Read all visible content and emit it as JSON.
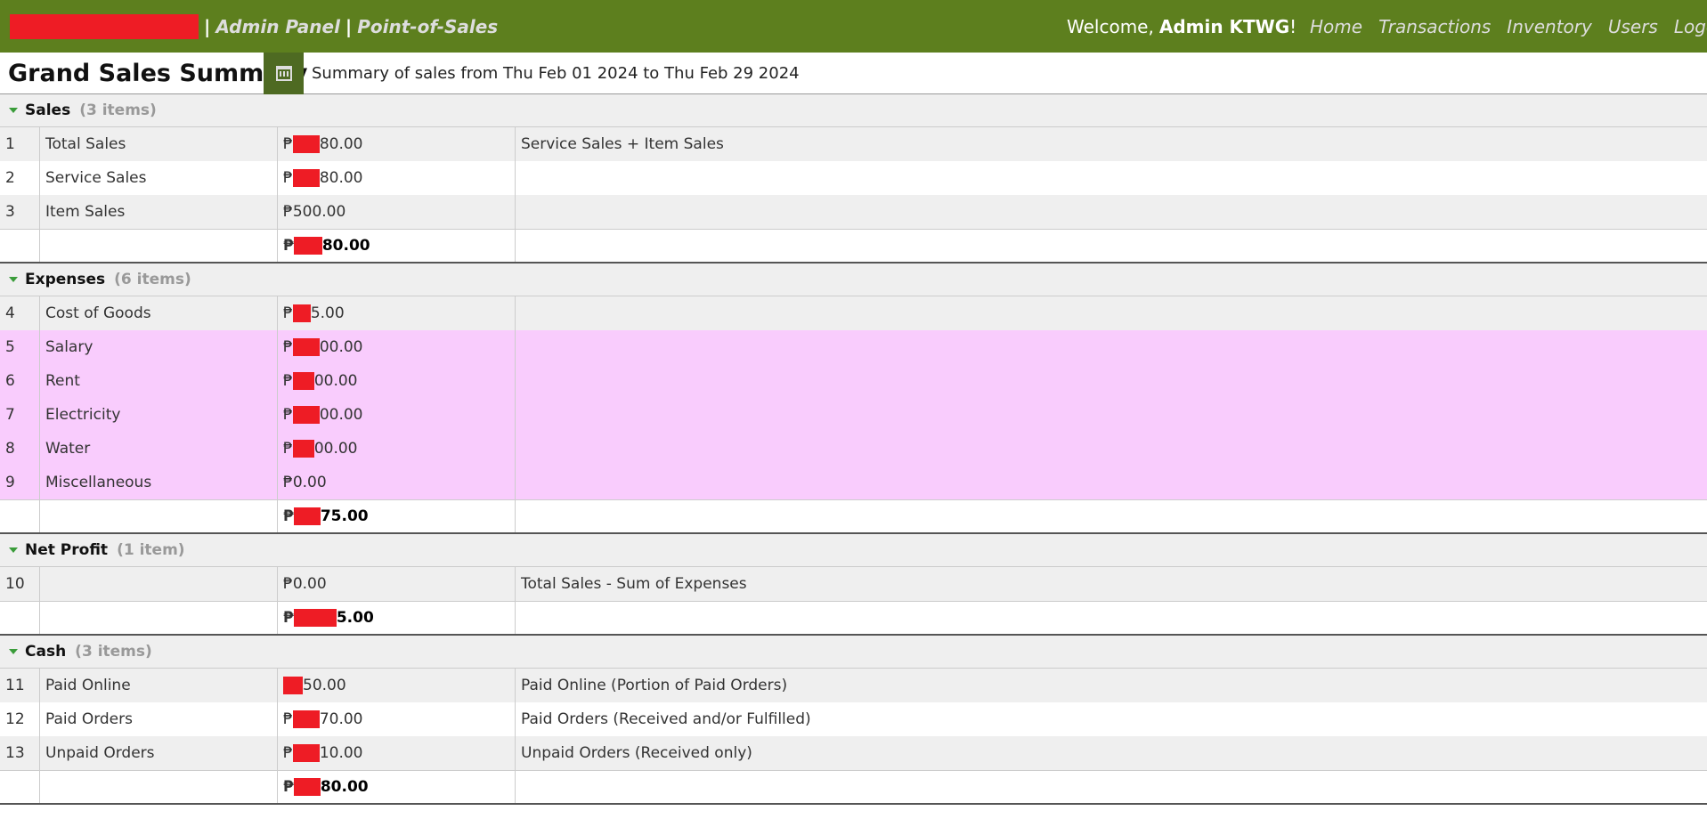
{
  "header": {
    "brand_parts": [
      "Admin Panel",
      "Point-of-Sales"
    ],
    "separator": "|",
    "welcome_prefix": "Welcome,",
    "welcome_user": "Admin KTWG",
    "welcome_suffix": "!",
    "nav": [
      "Home",
      "Transactions",
      "Inventory",
      "Users",
      "Logout"
    ]
  },
  "title": {
    "page_title": "Grand Sales Summary",
    "calendar_icon": "calendar-icon",
    "subtitle": "Summary of sales from Thu Feb 01 2024 to Thu Feb 29 2024"
  },
  "groups": [
    {
      "name": "Sales",
      "count": "(3 items)",
      "rows": [
        {
          "n": "1",
          "label": "Total Sales",
          "amount_prefix": "₱",
          "amount_suffix": "80.00",
          "note": "Service Sales + Item Sales"
        },
        {
          "n": "2",
          "label": "Service Sales",
          "amount_prefix": "₱",
          "amount_suffix": "80.00",
          "note": ""
        },
        {
          "n": "3",
          "label": "Item Sales",
          "amount_prefix": "₱500.00",
          "amount_suffix": "",
          "note": ""
        }
      ],
      "total_prefix": "₱",
      "total_suffix": "80.00"
    },
    {
      "name": "Expenses",
      "count": "(6 items)",
      "rows": [
        {
          "n": "4",
          "label": "Cost of Goods",
          "amount_prefix": "₱",
          "amount_suffix": "5.00",
          "note": ""
        },
        {
          "n": "5",
          "label": "Salary",
          "amount_prefix": "₱",
          "amount_suffix": "00.00",
          "note": ""
        },
        {
          "n": "6",
          "label": "Rent",
          "amount_prefix": "₱",
          "amount_suffix": "00.00",
          "note": ""
        },
        {
          "n": "7",
          "label": "Electricity",
          "amount_prefix": "₱",
          "amount_suffix": "00.00",
          "note": ""
        },
        {
          "n": "8",
          "label": "Water",
          "amount_prefix": "₱",
          "amount_suffix": "00.00",
          "note": ""
        },
        {
          "n": "9",
          "label": "Miscellaneous",
          "amount_prefix": "₱0.00",
          "amount_suffix": "",
          "note": ""
        }
      ],
      "total_prefix": "₱",
      "total_suffix": "75.00"
    },
    {
      "name": "Net Profit",
      "count": "(1 item)",
      "rows": [
        {
          "n": "10",
          "label": "",
          "amount_prefix": "₱0.00",
          "amount_suffix": "",
          "note": "Total Sales - Sum of Expenses"
        }
      ],
      "total_prefix": "₱",
      "total_suffix": "5.00"
    },
    {
      "name": "Cash",
      "count": "(3 items)",
      "rows": [
        {
          "n": "11",
          "label": "Paid Online",
          "amount_prefix": "",
          "amount_suffix": "50.00",
          "note": "Paid Online (Portion of Paid Orders)"
        },
        {
          "n": "12",
          "label": "Paid Orders",
          "amount_prefix": "₱",
          "amount_suffix": "70.00",
          "note": "Paid Orders (Received and/or Fulfilled)"
        },
        {
          "n": "13",
          "label": "Unpaid Orders",
          "amount_prefix": "₱",
          "amount_suffix": "10.00",
          "note": "Unpaid Orders (Received only)"
        }
      ],
      "total_prefix": "₱",
      "total_suffix": "80.00"
    }
  ],
  "colors": {
    "topbar": "#5d7f1e",
    "highlight_rows": "#f9ccfd",
    "redaction": "#ee1c25",
    "group_arrow": "#3a9c3a"
  }
}
